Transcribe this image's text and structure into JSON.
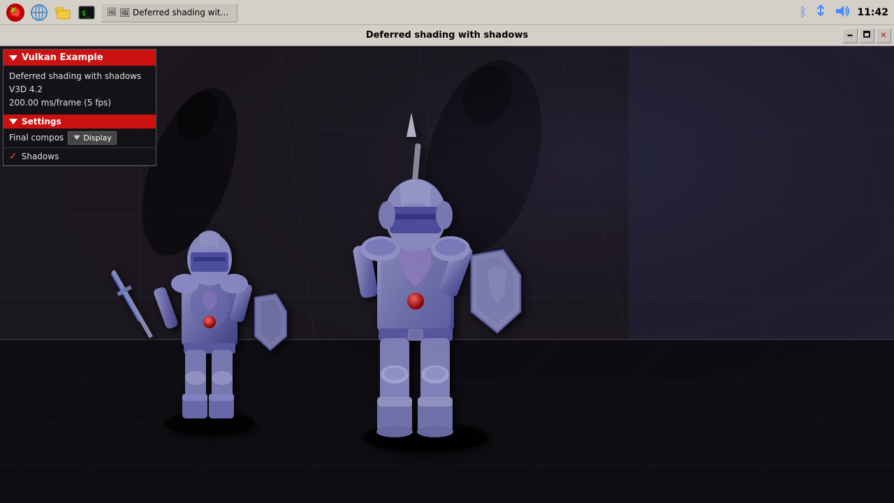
{
  "taskbar": {
    "app_title": "🖼 Deferred shading with s...",
    "time": "11:42",
    "icons": {
      "bluetooth": "ᛒ",
      "network": "⇅",
      "volume": "🔊"
    }
  },
  "window": {
    "title": "Deferred shading with shadows",
    "controls": {
      "minimize": "🗕",
      "maximize": "🗖",
      "close": "✕"
    }
  },
  "panel": {
    "header": "Vulkan Example",
    "info_line1": "Deferred shading with shadows",
    "info_line2": "V3D 4.2",
    "info_line3": "200.00 ms/frame (5 fps)",
    "settings_label": "Settings",
    "final_composite": "Final compos",
    "display_label": "Display",
    "shadows_label": "Shadows"
  }
}
